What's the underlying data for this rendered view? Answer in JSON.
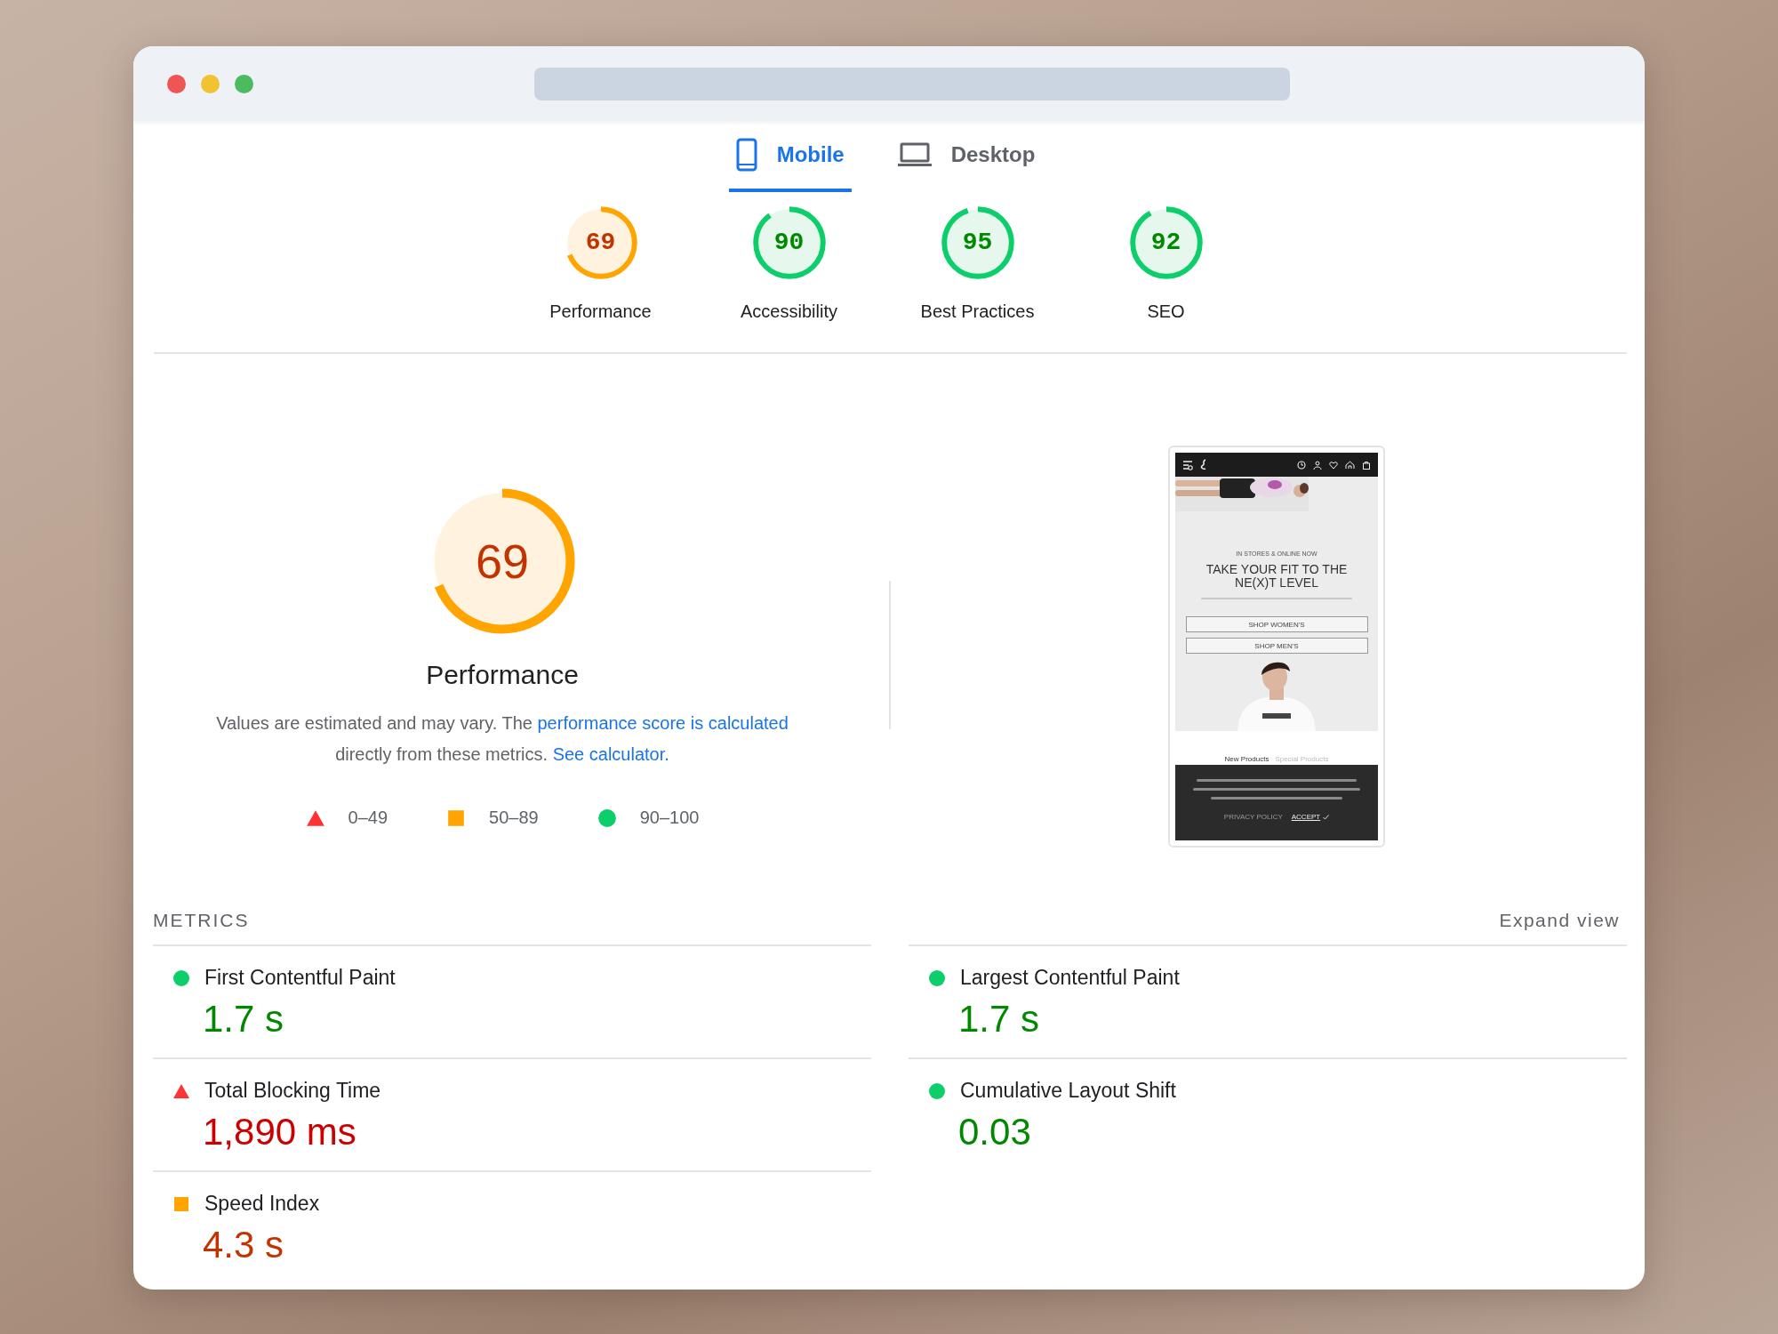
{
  "tabs": [
    {
      "label": "Mobile",
      "selected": true
    },
    {
      "label": "Desktop",
      "selected": false
    }
  ],
  "categories": [
    {
      "score": "69",
      "label": "Performance",
      "level": 0.69,
      "kind": "average"
    },
    {
      "score": "90",
      "label": "Accessibility",
      "level": 0.9,
      "kind": "pass"
    },
    {
      "score": "95",
      "label": "Best Practices",
      "level": 0.95,
      "kind": "pass"
    },
    {
      "score": "92",
      "label": "SEO",
      "level": 0.92,
      "kind": "pass"
    }
  ],
  "performance": {
    "score": "69",
    "level": 0.69,
    "kind": "average",
    "title": "Performance",
    "description": [
      {
        "text": "Values are estimated and may vary. The ",
        "link": false
      },
      {
        "text": "performance score is calculated",
        "link": true
      },
      {
        "text": " directly from these metrics. ",
        "link": false
      },
      {
        "text": "See calculator.",
        "link": true
      }
    ],
    "legend": [
      {
        "kind": "fail",
        "label": "0–49"
      },
      {
        "kind": "average",
        "label": "50–89"
      },
      {
        "kind": "pass",
        "label": "90–100"
      }
    ]
  },
  "screenshot": {
    "kicker": "IN STORES & ONLINE NOW",
    "headline": "TAKE YOUR FIT TO THE NE(X)T LEVEL",
    "buttons": [
      "SHOP WOMEN'S",
      "SHOP MEN'S"
    ],
    "tabs": [
      {
        "label": "New Products",
        "selected": true
      },
      {
        "label": "Special Products",
        "selected": false
      }
    ],
    "cookie_links": [
      "PRIVACY POLICY",
      "ACCEPT"
    ]
  },
  "metrics": {
    "heading": "METRICS",
    "expand": "Expand view",
    "items": [
      {
        "name": "First Contentful Paint",
        "value": "1.7 s",
        "kind": "pass"
      },
      {
        "name": "Largest Contentful Paint",
        "value": "1.7 s",
        "kind": "pass"
      },
      {
        "name": "Total Blocking Time",
        "value": "1,890 ms",
        "kind": "fail"
      },
      {
        "name": "Cumulative Layout Shift",
        "value": "0.03",
        "kind": "pass"
      },
      {
        "name": "Speed Index",
        "value": "4.3 s",
        "kind": "average"
      }
    ]
  }
}
